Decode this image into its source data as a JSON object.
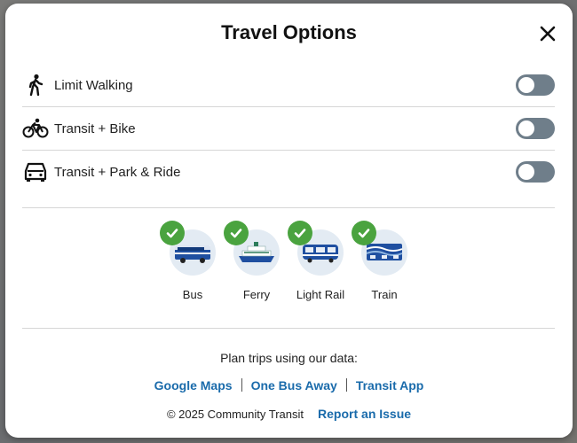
{
  "modal": {
    "title": "Travel Options",
    "close_icon": "close-icon"
  },
  "options": [
    {
      "label": "Limit Walking",
      "icon": "walking-person-icon",
      "enabled": false
    },
    {
      "label": "Transit + Bike",
      "icon": "bicycle-icon",
      "enabled": false
    },
    {
      "label": "Transit + Park & Ride",
      "icon": "car-icon",
      "enabled": false
    }
  ],
  "modes": [
    {
      "label": "Bus",
      "icon": "bus-icon",
      "selected": true
    },
    {
      "label": "Ferry",
      "icon": "ferry-icon",
      "selected": true
    },
    {
      "label": "Light Rail",
      "icon": "light-rail-icon",
      "selected": true
    },
    {
      "label": "Train",
      "icon": "train-icon",
      "selected": true
    }
  ],
  "footer": {
    "plan_text": "Plan trips using our data:",
    "links": [
      "Google Maps",
      "One Bus Away",
      "Transit App"
    ],
    "copyright": "© 2025 Community Transit",
    "report_link": "Report an Issue"
  },
  "colors": {
    "link": "#1a6bab",
    "check_green": "#4aa33f",
    "toggle_off": "#6f7e8a",
    "mode_circle": "#e3ebf3"
  }
}
